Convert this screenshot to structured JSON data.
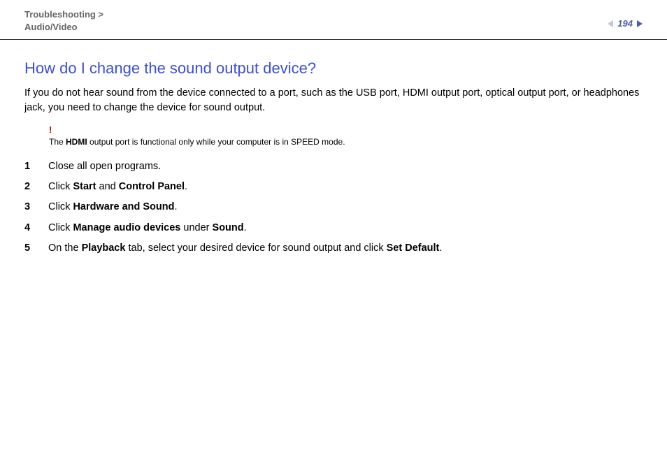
{
  "header": {
    "breadcrumb_line1": "Troubleshooting >",
    "breadcrumb_line2": "Audio/Video",
    "page_number": "194"
  },
  "content": {
    "title": "How do I change the sound output device?",
    "intro": "If you do not hear sound from the device connected to a port, such as the USB port, HDMI output port, optical output port, or headphones jack, you need to change the device for sound output.",
    "note": {
      "bang": "!",
      "prefix": "The ",
      "bold": "HDMI",
      "suffix": " output port is functional only while your computer is in SPEED mode."
    },
    "steps": [
      {
        "num": "1",
        "html": "Close all open programs."
      },
      {
        "num": "2",
        "html": "Click <b>Start</b> and <b>Control Panel</b>."
      },
      {
        "num": "3",
        "html": "Click <b>Hardware and Sound</b>."
      },
      {
        "num": "4",
        "html": "Click <b>Manage audio devices</b> under <b>Sound</b>."
      },
      {
        "num": "5",
        "html": "On the <b>Playback</b> tab, select your desired device for sound output and click <b>Set Default</b>."
      }
    ]
  }
}
